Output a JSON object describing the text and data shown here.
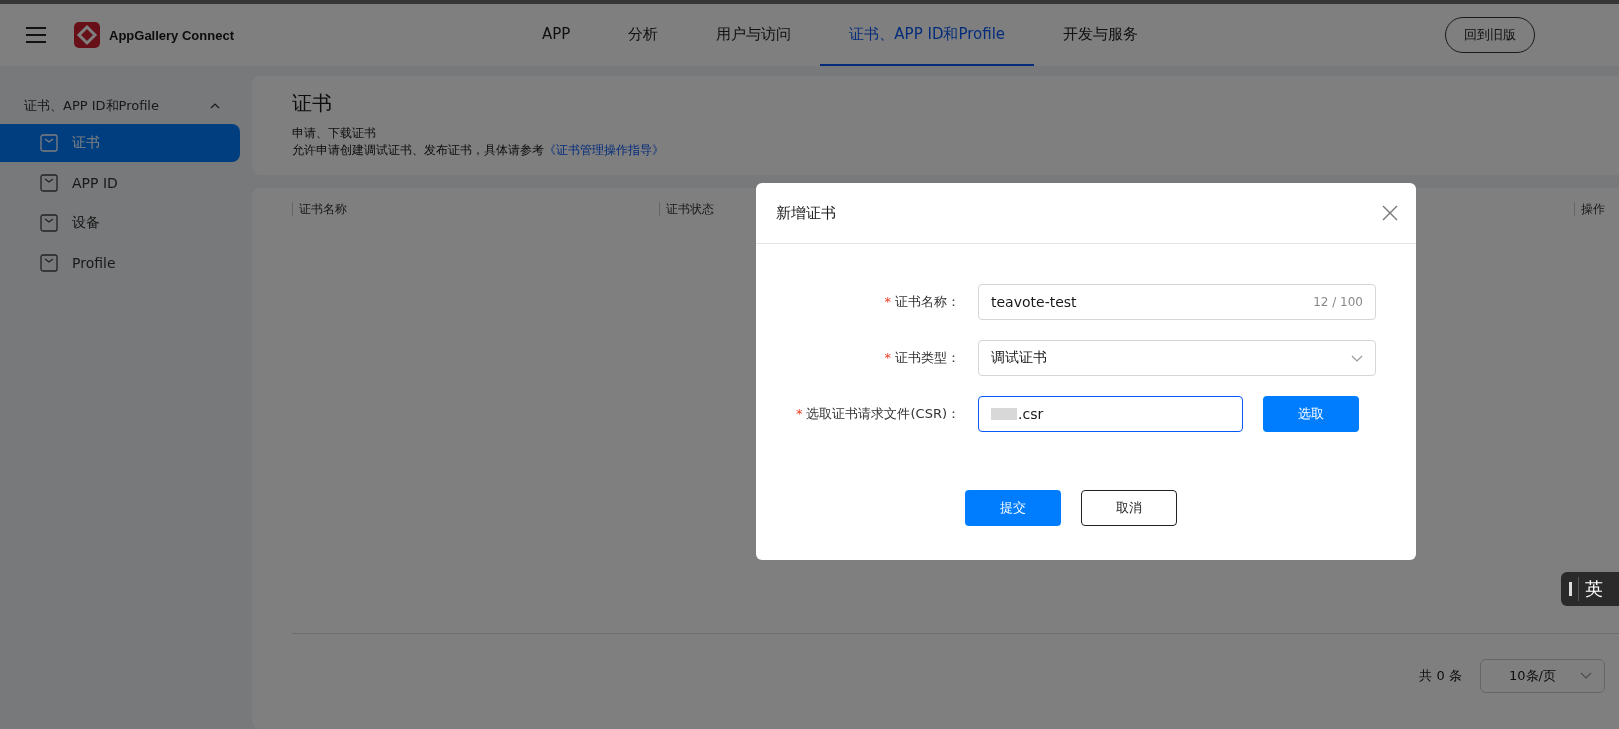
{
  "header": {
    "brand": "AppGallery Connect",
    "nav": [
      {
        "label": "APP",
        "selected": false
      },
      {
        "label": "分析",
        "selected": false
      },
      {
        "label": "用户与访问",
        "selected": false
      },
      {
        "label": "证书、APP ID和Profile",
        "selected": true
      },
      {
        "label": "开发与服务",
        "selected": false
      }
    ],
    "old_version_button": "回到旧版"
  },
  "sidebar": {
    "group": {
      "label": "证书、APP ID和Profile",
      "expanded": true
    },
    "items": [
      {
        "label": "证书",
        "selected": true
      },
      {
        "label": "APP ID",
        "selected": false
      },
      {
        "label": "设备",
        "selected": false
      },
      {
        "label": "Profile",
        "selected": false
      }
    ]
  },
  "page": {
    "title": "证书",
    "subtitle": "申请、下载证书",
    "description": "允许申请创建调试证书、发布证书，具体请参考",
    "guide_link": "《证书管理操作指导》"
  },
  "table": {
    "columns": [
      "证书名称",
      "证书状态",
      "操作"
    ],
    "pagination": {
      "total": "共 0 条",
      "page_size": "10条/页"
    }
  },
  "dialog": {
    "title": "新增证书",
    "fields": [
      {
        "kind": "text",
        "label": "证书名称：",
        "required_mark": "*",
        "value": "teavote-test",
        "counter": "12 / 100"
      },
      {
        "kind": "select",
        "label": "证书类型：",
        "required_mark": "*",
        "value": "调试证书"
      },
      {
        "kind": "file",
        "label": "选取证书请求文件(CSR)：",
        "required_mark": "*",
        "value": ".csr",
        "redacted": true,
        "button": "选取"
      }
    ],
    "submit": "提交",
    "cancel": "取消"
  },
  "ime": {
    "mode": "英"
  }
}
